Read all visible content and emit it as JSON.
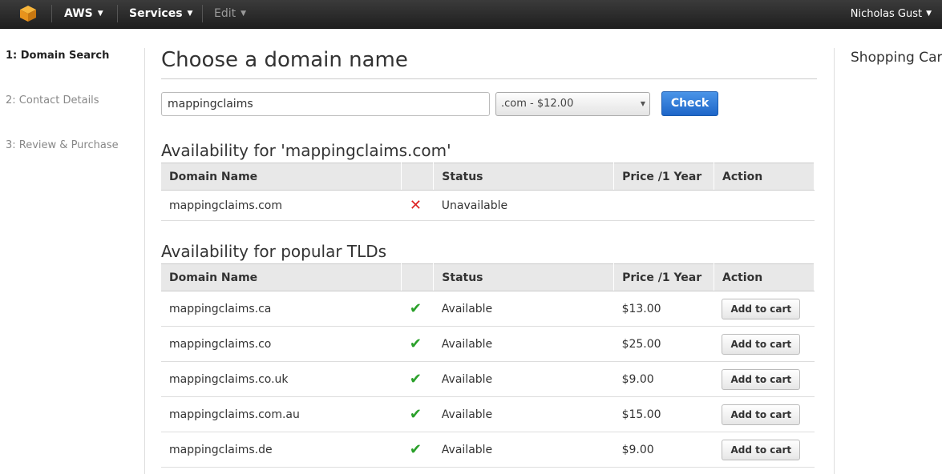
{
  "nav": {
    "aws_label": "AWS",
    "services_label": "Services",
    "edit_label": "Edit",
    "user_label": "Nicholas Gust",
    "logo_icon": "aws-cube-icon",
    "brand_color": "#f0a326"
  },
  "steps": [
    {
      "label": "1: Domain Search"
    },
    {
      "label": "2: Contact Details"
    },
    {
      "label": "3: Review & Purchase"
    }
  ],
  "main": {
    "title": "Choose a domain name",
    "search_value": "mappingclaims",
    "tld_selected": ".com - $12.00",
    "check_label": "Check"
  },
  "availability": {
    "title": "Availability for 'mappingclaims.com'",
    "headers": [
      "Domain Name",
      "",
      "Status",
      "Price /1 Year",
      "Action"
    ],
    "rows": [
      {
        "domain": "mappingclaims.com",
        "icon": "cross-icon",
        "status": "Unavailable",
        "price": "",
        "action": ""
      }
    ]
  },
  "popular": {
    "title": "Availability for popular TLDs",
    "headers": [
      "Domain Name",
      "",
      "Status",
      "Price /1 Year",
      "Action"
    ],
    "rows": [
      {
        "domain": "mappingclaims.ca",
        "status": "Available",
        "price": "$13.00",
        "action": "Add to cart"
      },
      {
        "domain": "mappingclaims.co",
        "status": "Available",
        "price": "$25.00",
        "action": "Add to cart"
      },
      {
        "domain": "mappingclaims.co.uk",
        "status": "Available",
        "price": "$9.00",
        "action": "Add to cart"
      },
      {
        "domain": "mappingclaims.com.au",
        "status": "Available",
        "price": "$15.00",
        "action": "Add to cart"
      },
      {
        "domain": "mappingclaims.de",
        "status": "Available",
        "price": "$9.00",
        "action": "Add to cart"
      }
    ]
  },
  "cart": {
    "title": "Shopping Cart"
  },
  "colors": {
    "check_button": "#2a74d6",
    "available_tick": "#2aa02a",
    "unavailable_cross": "#dd2222"
  }
}
